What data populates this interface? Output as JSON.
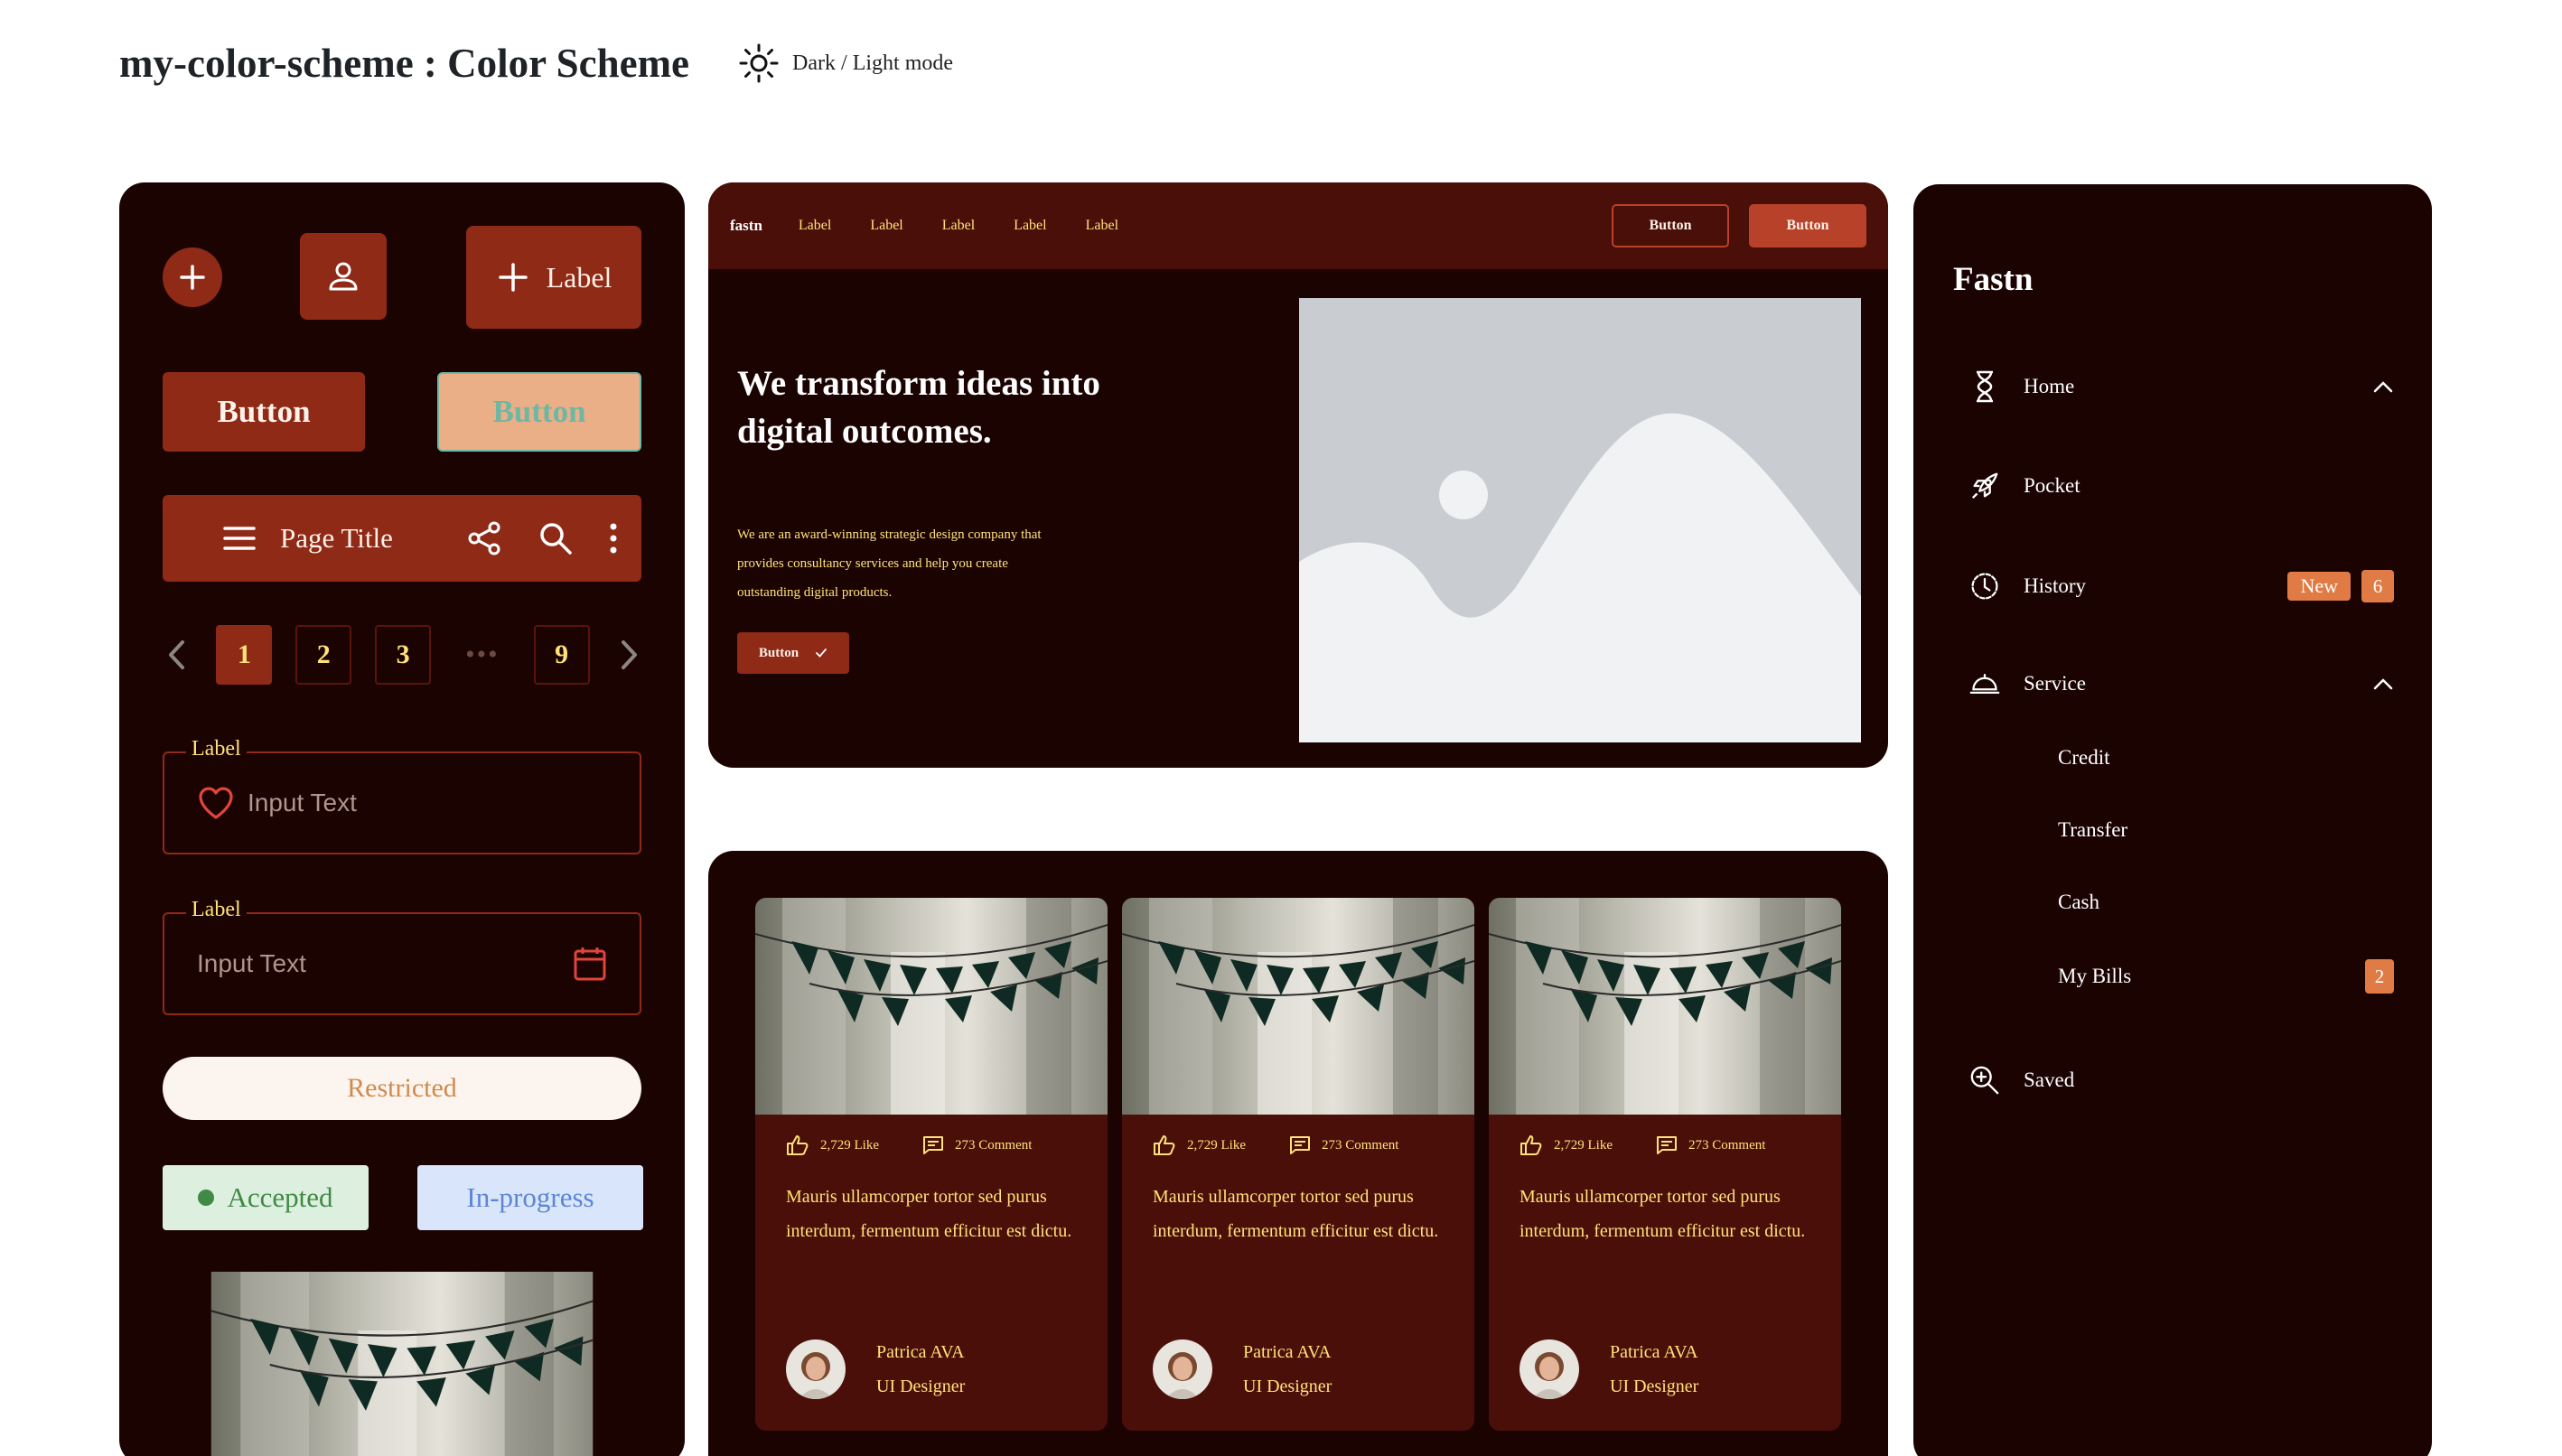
{
  "header": {
    "title": "my-color-scheme : Color Scheme",
    "mode_label": "Dark / Light mode"
  },
  "colors": {
    "panel_bg": "#1b0302",
    "primary": "#8f2a16",
    "card_bg": "#4a0f08",
    "accent_text": "#ffe27a",
    "badge": "#e07b45"
  },
  "components": {
    "fab_extended_label": "Label",
    "button_primary": "Button",
    "button_disabled": "Button",
    "appbar_title": "Page Title",
    "pagination": {
      "pages": [
        "1",
        "2",
        "3",
        "9"
      ],
      "ellipsis": "•••",
      "active": "1"
    },
    "field1": {
      "label": "Label",
      "value": "Input Text",
      "icon": "heart-icon"
    },
    "field2": {
      "label": "Label",
      "value": "Input Text",
      "icon": "calendar-icon"
    },
    "chip_restricted": "Restricted",
    "chip_accepted": "Accepted",
    "chip_progress": "In-progress"
  },
  "hero": {
    "brand": "fastn",
    "nav_links": [
      "Label",
      "Label",
      "Label",
      "Label",
      "Label"
    ],
    "nav_btn_outline": "Button",
    "nav_btn_solid": "Button",
    "headline": "We transform ideas into digital outcomes.",
    "description": "We are an award-winning strategic design company that provides consultancy services and help you create outstanding digital products.",
    "cta": "Button"
  },
  "cards": [
    {
      "likes": "2,729 Like",
      "comments": "273 Comment",
      "text": "Mauris ullamcorper tortor sed purus interdum, fermentum efficitur est dictu.",
      "author": "Patrica AVA",
      "role": "UI Designer"
    },
    {
      "likes": "2,729 Like",
      "comments": "273 Comment",
      "text": "Mauris ullamcorper tortor sed purus interdum, fermentum efficitur est dictu.",
      "author": "Patrica AVA",
      "role": "UI Designer"
    },
    {
      "likes": "2,729 Like",
      "comments": "273 Comment",
      "text": "Mauris ullamcorper tortor sed purus interdum, fermentum efficitur est dictu.",
      "author": "Patrica AVA",
      "role": "UI Designer"
    }
  ],
  "sidebar": {
    "brand": "Fastn",
    "items": [
      {
        "label": "Home",
        "icon": "hourglass-icon"
      },
      {
        "label": "Pocket",
        "icon": "rocket-icon"
      },
      {
        "label": "History",
        "icon": "clock-icon",
        "badge_new": "New",
        "badge_count": "6"
      },
      {
        "label": "Service",
        "icon": "service-bell-icon"
      },
      {
        "label": "Saved",
        "icon": "zoom-in-icon"
      }
    ],
    "sub_items": [
      {
        "label": "Credit"
      },
      {
        "label": "Transfer"
      },
      {
        "label": "Cash"
      },
      {
        "label": "My Bills",
        "badge_count": "2"
      }
    ]
  }
}
